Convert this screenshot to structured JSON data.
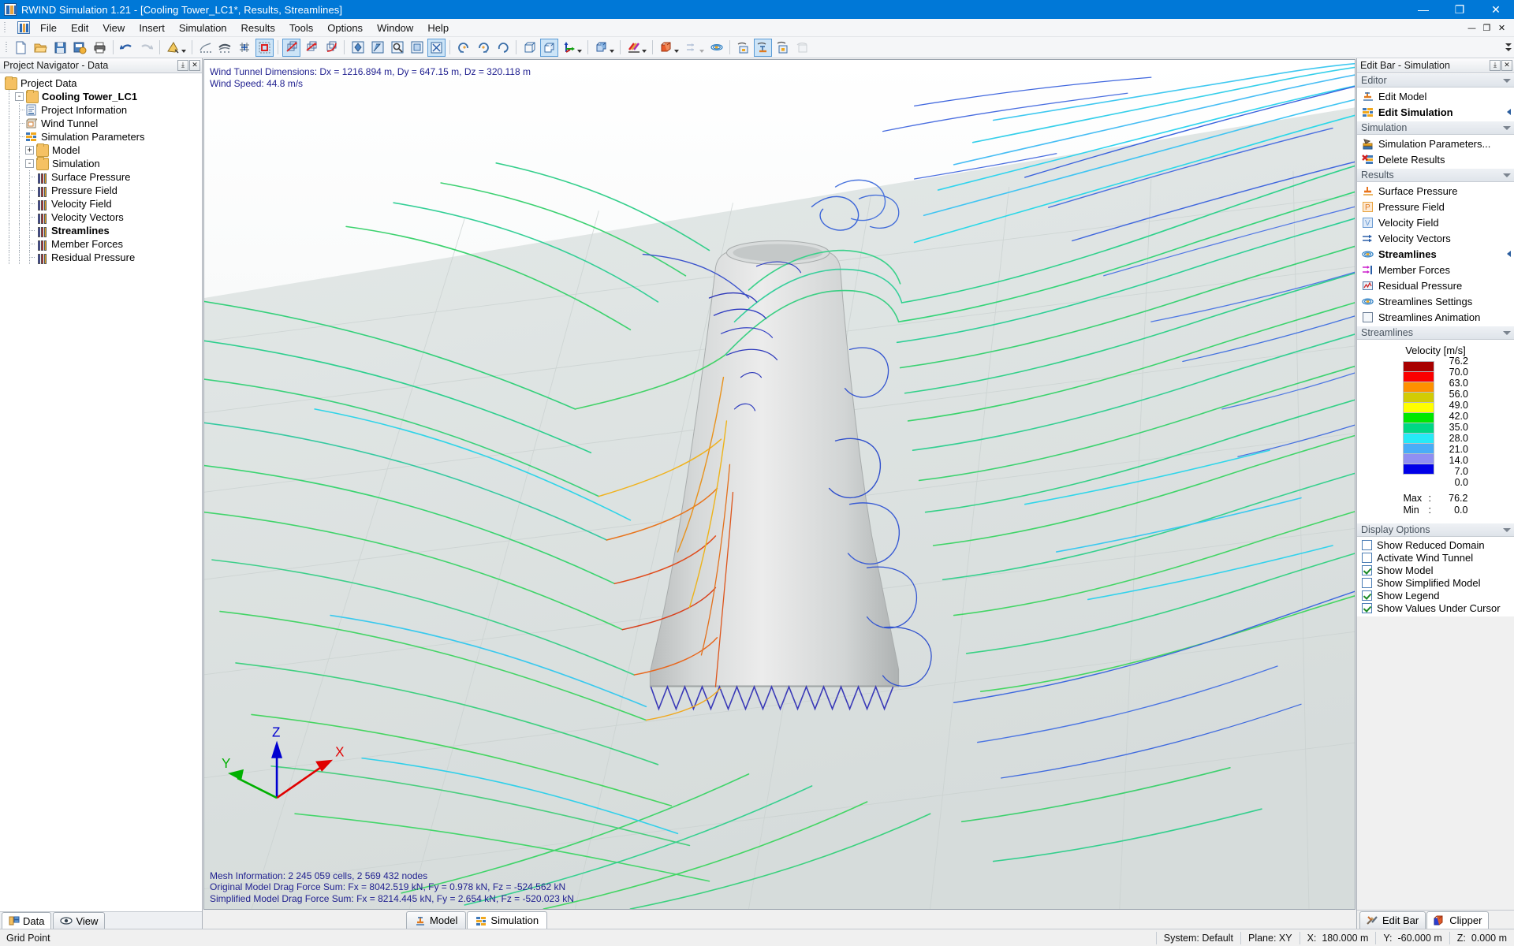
{
  "window": {
    "title": "RWIND Simulation 1.21 - [Cooling Tower_LC1*, Results, Streamlines]",
    "minimize": "—",
    "restore": "❐",
    "close": "✕",
    "mdi_minimize": "—",
    "mdi_restore": "❐",
    "mdi_close": "✕"
  },
  "menu": {
    "items": [
      "File",
      "Edit",
      "View",
      "Insert",
      "Simulation",
      "Results",
      "Tools",
      "Options",
      "Window",
      "Help"
    ]
  },
  "navigator": {
    "title": "Project Navigator - Data",
    "pin": "⤓",
    "close": "✕",
    "tree": [
      {
        "label": "Project Data",
        "icon": "folder-icon",
        "depth": 0,
        "expander": "",
        "bold": false
      },
      {
        "label": "Cooling Tower_LC1",
        "icon": "folder-icon",
        "depth": 1,
        "expander": "-",
        "bold": true
      },
      {
        "label": "Project Information",
        "icon": "project-info-icon",
        "depth": 2,
        "expander": "",
        "bold": false
      },
      {
        "label": "Wind Tunnel",
        "icon": "wind-tunnel-icon",
        "depth": 2,
        "expander": "",
        "bold": false
      },
      {
        "label": "Simulation Parameters",
        "icon": "simulation-params-icon",
        "depth": 2,
        "expander": "",
        "bold": false
      },
      {
        "label": "Model",
        "icon": "folder-icon",
        "depth": 2,
        "expander": "+",
        "bold": false
      },
      {
        "label": "Simulation",
        "icon": "folder-icon",
        "depth": 2,
        "expander": "-",
        "bold": false
      },
      {
        "label": "Surface Pressure",
        "icon": "result-bars-icon",
        "depth": 3,
        "expander": "",
        "bold": false
      },
      {
        "label": "Pressure Field",
        "icon": "result-bars-icon",
        "depth": 3,
        "expander": "",
        "bold": false
      },
      {
        "label": "Velocity Field",
        "icon": "result-bars-icon",
        "depth": 3,
        "expander": "",
        "bold": false
      },
      {
        "label": "Velocity Vectors",
        "icon": "result-bars-icon",
        "depth": 3,
        "expander": "",
        "bold": false
      },
      {
        "label": "Streamlines",
        "icon": "result-bars-icon",
        "depth": 3,
        "expander": "",
        "bold": true
      },
      {
        "label": "Member Forces",
        "icon": "result-bars-icon",
        "depth": 3,
        "expander": "",
        "bold": false
      },
      {
        "label": "Residual Pressure",
        "icon": "result-bars-icon",
        "depth": 3,
        "expander": "",
        "bold": false
      }
    ],
    "tabs": [
      {
        "label": "Data",
        "icon": "data-icon",
        "selected": true
      },
      {
        "label": "View",
        "icon": "eye-icon",
        "selected": false
      }
    ]
  },
  "viewport": {
    "info_top": "Wind Tunnel Dimensions: Dx = 1216.894 m, Dy = 647.15 m, Dz = 320.118 m\nWind Speed: 44.8 m/s",
    "info_bottom": "Mesh Information: 2 245 059 cells, 2 569 432 nodes\nOriginal Model Drag Force Sum: Fx = 8042.519 kN, Fy = 0.978 kN, Fz = -524.562 kN\nSimplified Model Drag Force Sum: Fx = 8214.445 kN, Fy = 2.654 kN, Fz = -520.023 kN",
    "axis": {
      "x": "X",
      "y": "Y",
      "z": "Z",
      "x_color": "#e00000",
      "y_color": "#00b000",
      "z_color": "#0000d0"
    },
    "tabs": [
      {
        "label": "Model",
        "icon": "model-icon",
        "selected": false
      },
      {
        "label": "Simulation",
        "icon": "simulation-icon",
        "selected": true
      }
    ]
  },
  "editbar": {
    "title": "Edit Bar - Simulation",
    "pin": "⤓",
    "close": "✕",
    "sections": {
      "editor": {
        "title": "Editor",
        "items": [
          {
            "label": "Edit Model",
            "icon": "edit-model-icon",
            "bold": false,
            "arrow": false
          },
          {
            "label": "Edit Simulation",
            "icon": "edit-simulation-icon",
            "bold": true,
            "arrow": true
          }
        ]
      },
      "simulation": {
        "title": "Simulation",
        "items": [
          {
            "label": "Simulation Parameters...",
            "icon": "simulation-params-icon",
            "bold": false,
            "arrow": false
          },
          {
            "label": "Delete Results",
            "icon": "delete-results-icon",
            "bold": false,
            "arrow": false
          }
        ]
      },
      "results": {
        "title": "Results",
        "items": [
          {
            "label": "Surface Pressure",
            "icon": "surface-pressure-icon",
            "bold": false,
            "arrow": false
          },
          {
            "label": "Pressure Field",
            "icon": "pressure-field-icon",
            "bold": false,
            "arrow": false
          },
          {
            "label": "Velocity Field",
            "icon": "velocity-field-icon",
            "bold": false,
            "arrow": false
          },
          {
            "label": "Velocity Vectors",
            "icon": "velocity-vectors-icon",
            "bold": false,
            "arrow": false
          },
          {
            "label": "Streamlines",
            "icon": "streamlines-icon",
            "bold": true,
            "arrow": true
          },
          {
            "label": "Member Forces",
            "icon": "member-forces-icon",
            "bold": false,
            "arrow": false
          },
          {
            "label": "Residual Pressure",
            "icon": "residual-pressure-icon",
            "bold": false,
            "arrow": false
          },
          {
            "label": "Streamlines Settings",
            "icon": "streamlines-settings-icon",
            "bold": false,
            "arrow": false
          },
          {
            "label": "Streamlines Animation",
            "icon": "streamlines-animation-icon",
            "bold": false,
            "arrow": false
          }
        ]
      },
      "streamlines": {
        "title": "Streamlines",
        "legend_title": "Velocity [m/s]",
        "max_label": "Max",
        "min_label": "Min",
        "colon": ":",
        "max_value": "76.2",
        "min_value": "0.0"
      },
      "display_options": {
        "title": "Display Options",
        "items": [
          {
            "label": "Show Reduced Domain",
            "checked": false
          },
          {
            "label": "Activate Wind Tunnel",
            "checked": false
          },
          {
            "label": "Show Model",
            "checked": true
          },
          {
            "label": "Show Simplified Model",
            "checked": false
          },
          {
            "label": "Show Legend",
            "checked": true
          },
          {
            "label": "Show Values Under Cursor",
            "checked": true
          }
        ]
      }
    },
    "tabs": [
      {
        "label": "Edit Bar",
        "icon": "tools-icon",
        "selected": false
      },
      {
        "label": "Clipper",
        "icon": "clipper-icon",
        "selected": true
      }
    ]
  },
  "chart_data": {
    "type": "heatmap",
    "title": "Velocity [m/s]",
    "ylabel": "Velocity [m/s]",
    "colorbar_ticks": [
      "76.2",
      "70.0",
      "63.0",
      "56.0",
      "49.0",
      "42.0",
      "35.0",
      "28.0",
      "21.0",
      "14.0",
      "7.0",
      "0.0"
    ],
    "colorbar_values": [
      76.2,
      70.0,
      63.0,
      56.0,
      49.0,
      42.0,
      35.0,
      28.0,
      21.0,
      14.0,
      7.0,
      0.0
    ],
    "colorbar_colors": [
      "#a80000",
      "#fb0000",
      "#fe9000",
      "#d2cb04",
      "#ffff00",
      "#00e800",
      "#00d884",
      "#26eaf6",
      "#49adf7",
      "#8f8ff2",
      "#0000e8"
    ],
    "band_count": 11,
    "max": 76.2,
    "min": 0.0,
    "units": "m/s"
  },
  "statusbar": {
    "left": "Grid Point",
    "cells": [
      "System: Default",
      "Plane: XY",
      "X:  180.000 m",
      "Y:  -60.000 m",
      "Z:  0.000 m"
    ]
  }
}
